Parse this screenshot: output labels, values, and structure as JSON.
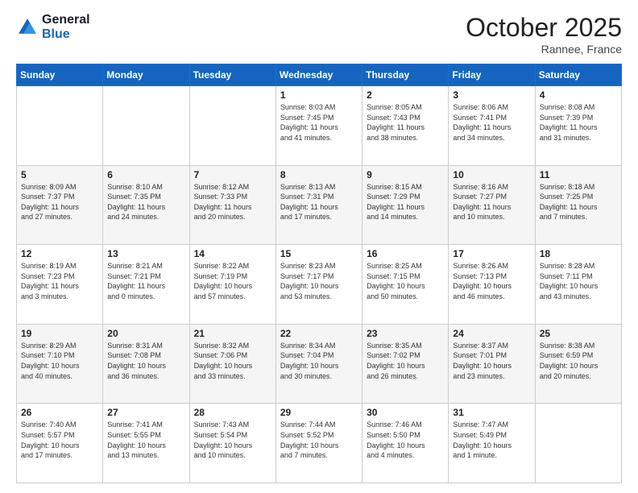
{
  "header": {
    "logo_line1": "General",
    "logo_line2": "Blue",
    "month": "October 2025",
    "location": "Rannee, France"
  },
  "weekdays": [
    "Sunday",
    "Monday",
    "Tuesday",
    "Wednesday",
    "Thursday",
    "Friday",
    "Saturday"
  ],
  "weeks": [
    [
      {
        "day": "",
        "info": ""
      },
      {
        "day": "",
        "info": ""
      },
      {
        "day": "",
        "info": ""
      },
      {
        "day": "1",
        "info": "Sunrise: 8:03 AM\nSunset: 7:45 PM\nDaylight: 11 hours\nand 41 minutes."
      },
      {
        "day": "2",
        "info": "Sunrise: 8:05 AM\nSunset: 7:43 PM\nDaylight: 11 hours\nand 38 minutes."
      },
      {
        "day": "3",
        "info": "Sunrise: 8:06 AM\nSunset: 7:41 PM\nDaylight: 11 hours\nand 34 minutes."
      },
      {
        "day": "4",
        "info": "Sunrise: 8:08 AM\nSunset: 7:39 PM\nDaylight: 11 hours\nand 31 minutes."
      }
    ],
    [
      {
        "day": "5",
        "info": "Sunrise: 8:09 AM\nSunset: 7:37 PM\nDaylight: 11 hours\nand 27 minutes."
      },
      {
        "day": "6",
        "info": "Sunrise: 8:10 AM\nSunset: 7:35 PM\nDaylight: 11 hours\nand 24 minutes."
      },
      {
        "day": "7",
        "info": "Sunrise: 8:12 AM\nSunset: 7:33 PM\nDaylight: 11 hours\nand 20 minutes."
      },
      {
        "day": "8",
        "info": "Sunrise: 8:13 AM\nSunset: 7:31 PM\nDaylight: 11 hours\nand 17 minutes."
      },
      {
        "day": "9",
        "info": "Sunrise: 8:15 AM\nSunset: 7:29 PM\nDaylight: 11 hours\nand 14 minutes."
      },
      {
        "day": "10",
        "info": "Sunrise: 8:16 AM\nSunset: 7:27 PM\nDaylight: 11 hours\nand 10 minutes."
      },
      {
        "day": "11",
        "info": "Sunrise: 8:18 AM\nSunset: 7:25 PM\nDaylight: 11 hours\nand 7 minutes."
      }
    ],
    [
      {
        "day": "12",
        "info": "Sunrise: 8:19 AM\nSunset: 7:23 PM\nDaylight: 11 hours\nand 3 minutes."
      },
      {
        "day": "13",
        "info": "Sunrise: 8:21 AM\nSunset: 7:21 PM\nDaylight: 11 hours\nand 0 minutes."
      },
      {
        "day": "14",
        "info": "Sunrise: 8:22 AM\nSunset: 7:19 PM\nDaylight: 10 hours\nand 57 minutes."
      },
      {
        "day": "15",
        "info": "Sunrise: 8:23 AM\nSunset: 7:17 PM\nDaylight: 10 hours\nand 53 minutes."
      },
      {
        "day": "16",
        "info": "Sunrise: 8:25 AM\nSunset: 7:15 PM\nDaylight: 10 hours\nand 50 minutes."
      },
      {
        "day": "17",
        "info": "Sunrise: 8:26 AM\nSunset: 7:13 PM\nDaylight: 10 hours\nand 46 minutes."
      },
      {
        "day": "18",
        "info": "Sunrise: 8:28 AM\nSunset: 7:11 PM\nDaylight: 10 hours\nand 43 minutes."
      }
    ],
    [
      {
        "day": "19",
        "info": "Sunrise: 8:29 AM\nSunset: 7:10 PM\nDaylight: 10 hours\nand 40 minutes."
      },
      {
        "day": "20",
        "info": "Sunrise: 8:31 AM\nSunset: 7:08 PM\nDaylight: 10 hours\nand 36 minutes."
      },
      {
        "day": "21",
        "info": "Sunrise: 8:32 AM\nSunset: 7:06 PM\nDaylight: 10 hours\nand 33 minutes."
      },
      {
        "day": "22",
        "info": "Sunrise: 8:34 AM\nSunset: 7:04 PM\nDaylight: 10 hours\nand 30 minutes."
      },
      {
        "day": "23",
        "info": "Sunrise: 8:35 AM\nSunset: 7:02 PM\nDaylight: 10 hours\nand 26 minutes."
      },
      {
        "day": "24",
        "info": "Sunrise: 8:37 AM\nSunset: 7:01 PM\nDaylight: 10 hours\nand 23 minutes."
      },
      {
        "day": "25",
        "info": "Sunrise: 8:38 AM\nSunset: 6:59 PM\nDaylight: 10 hours\nand 20 minutes."
      }
    ],
    [
      {
        "day": "26",
        "info": "Sunrise: 7:40 AM\nSunset: 5:57 PM\nDaylight: 10 hours\nand 17 minutes."
      },
      {
        "day": "27",
        "info": "Sunrise: 7:41 AM\nSunset: 5:55 PM\nDaylight: 10 hours\nand 13 minutes."
      },
      {
        "day": "28",
        "info": "Sunrise: 7:43 AM\nSunset: 5:54 PM\nDaylight: 10 hours\nand 10 minutes."
      },
      {
        "day": "29",
        "info": "Sunrise: 7:44 AM\nSunset: 5:52 PM\nDaylight: 10 hours\nand 7 minutes."
      },
      {
        "day": "30",
        "info": "Sunrise: 7:46 AM\nSunset: 5:50 PM\nDaylight: 10 hours\nand 4 minutes."
      },
      {
        "day": "31",
        "info": "Sunrise: 7:47 AM\nSunset: 5:49 PM\nDaylight: 10 hours\nand 1 minute."
      },
      {
        "day": "",
        "info": ""
      }
    ]
  ]
}
